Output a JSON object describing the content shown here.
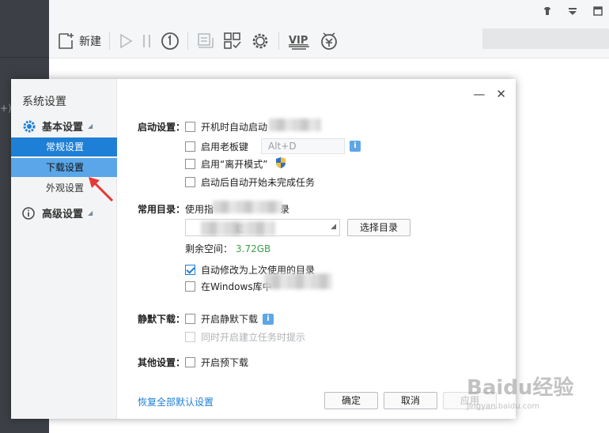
{
  "app": {
    "left_paren": "+)",
    "toolbar": {
      "new_label": "新建",
      "icons": [
        "new-task-icon",
        "play-icon",
        "pause-icon",
        "speed-limit-icon",
        "batch-icon",
        "browse-icon",
        "settings-gear-icon",
        "vip-icon",
        "finance-icon"
      ],
      "vip_text": "VIP"
    },
    "window_controls": [
      "skin-icon",
      "menu-icon",
      "minimize-icon"
    ]
  },
  "dialog": {
    "title": "系统设置",
    "nav": {
      "basic_group": "基本设置",
      "items": [
        {
          "label": "常规设置",
          "state": "active"
        },
        {
          "label": "下载设置",
          "state": "hover"
        },
        {
          "label": "外观设置",
          "state": "normal"
        }
      ],
      "advanced_group": "高级设置"
    },
    "controls": [
      "—",
      "✕"
    ],
    "startup": {
      "label": "启动设置：",
      "auto_start": "开机时自动启动",
      "boss_key": "启用老板键",
      "boss_key_value": "Alt+D",
      "away_mode": "启用“离开模式”",
      "resume_tasks": "启动后自动开始未完成任务"
    },
    "directory": {
      "label": "常用目录：",
      "desc_prefix": "使用指",
      "desc_suffix": "录",
      "select_path": "载",
      "choose_button": "选择目录",
      "free_space_label": "剩余空间：",
      "free_space_value": "3.72GB",
      "auto_change": "自动修改为上次使用的目录",
      "windows_lib": "在Windows库中"
    },
    "silent": {
      "label": "静默下载：",
      "enable": "开启静默下载",
      "also_prompt": "同时开启建立任务时提示"
    },
    "other": {
      "label": "其他设置：",
      "predownload": "开启预下载"
    },
    "restore_link": "恢复全部默认设置",
    "ok_button": "确定",
    "cancel_button": "取消",
    "apply_button": "应用",
    "colors": {
      "accent": "#1e7fd6",
      "hover": "#5aa6e8",
      "free_space": "#3aa14a"
    }
  },
  "watermark": {
    "brand": "Baidu经验",
    "sub": "jingyan.baidu.com"
  }
}
